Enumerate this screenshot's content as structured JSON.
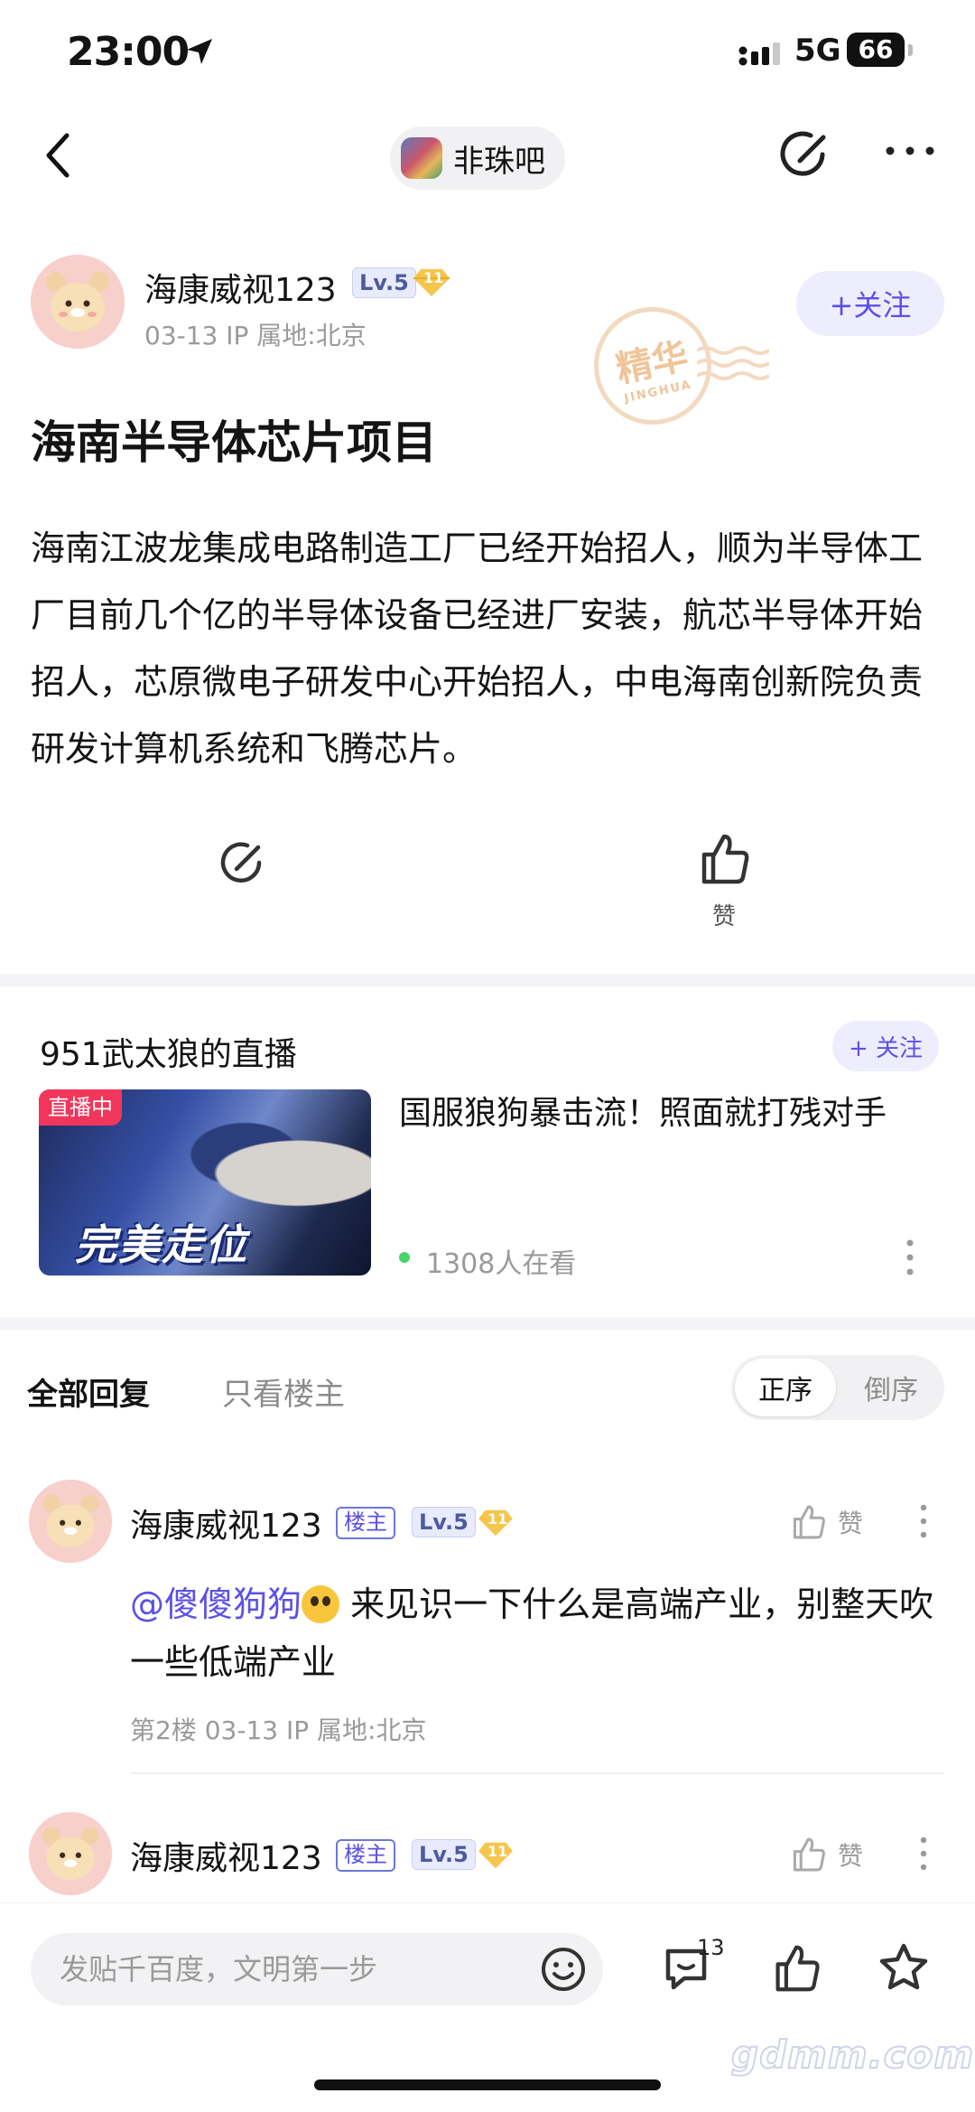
{
  "status_bar": {
    "time": "23:00",
    "network": "5G",
    "battery": "66"
  },
  "nav": {
    "forum_name": "非珠吧"
  },
  "post": {
    "author": {
      "name": "海康威视123",
      "level": "Lv.5",
      "crown_level": "11",
      "meta": "03-13   IP 属地:北京"
    },
    "follow_label": "+关注",
    "stamp": {
      "top": "精华",
      "bottom": "JINGHUA"
    },
    "title": "海南半导体芯片项目",
    "body": "海南江波龙集成电路制造工厂已经开始招人，顺为半导体工厂目前几个亿的半导体设备已经进厂安装，航芯半导体开始招人，芯原微电子研发中心开始招人，中电海南创新院负责研发计算机系统和飞腾芯片。",
    "like_label": "赞"
  },
  "live": {
    "title": "951武太狼的直播",
    "follow_label": "+ 关注",
    "badge": "直播中",
    "overlay_text": "完美走位",
    "headline": "国服狼狗暴击流！照面就打残对手",
    "viewers": "1308人在看"
  },
  "replies": {
    "tabs": {
      "all": "全部回复",
      "owner_only": "只看楼主"
    },
    "sort": {
      "asc": "正序",
      "desc": "倒序"
    },
    "items": [
      {
        "name": "海康威视123",
        "owner_badge": "楼主",
        "level": "Lv.5",
        "crown_level": "11",
        "like_label": "赞",
        "mention": "@傻傻狗狗",
        "text": " 来见识一下什么是高端产业，别整天吹一些低端产业",
        "meta": "第2楼   03-13   IP 属地:北京"
      },
      {
        "name": "海康威视123",
        "owner_badge": "楼主",
        "level": "Lv.5",
        "crown_level": "11",
        "like_label": "赞"
      }
    ]
  },
  "bottom_bar": {
    "placeholder": "发贴千百度，文明第一步",
    "comment_count": "13"
  },
  "watermark": "gdmm.com",
  "colors": {
    "accent": "#5b50e6",
    "live_badge": "#f0365a",
    "online_dot": "#47d56a"
  }
}
